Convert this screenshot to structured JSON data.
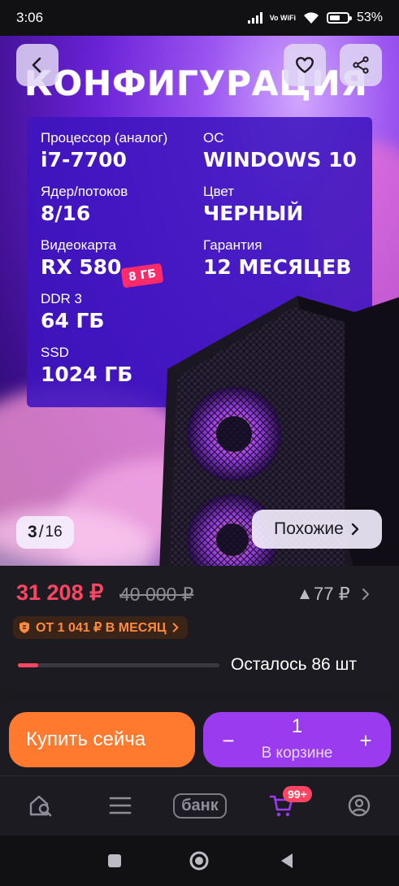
{
  "status_bar": {
    "time": "3:06",
    "network_label": "Vo WiFi",
    "battery": "53%"
  },
  "hero": {
    "title": "КОНФИГУРАЦИЯ",
    "specs": [
      {
        "label": "Процессор (аналог)",
        "value": "i7-7700"
      },
      {
        "label": "ОС",
        "value": "WINDOWS 10"
      },
      {
        "label": "Ядер/потоков",
        "value": "8/16"
      },
      {
        "label": "Цвет",
        "value": "ЧЕРНЫЙ"
      },
      {
        "label": "Видеокарта",
        "value": "RX 580"
      },
      {
        "label": "Гарантия",
        "value": "12 МЕСЯЦЕВ"
      },
      {
        "label": "DDR 3",
        "value": "64 ГБ"
      },
      {
        "label": "SSD",
        "value": "1024 ГБ"
      }
    ],
    "vram_badge": "8 ГБ",
    "gallery": {
      "current": "3",
      "separator": "/",
      "total": "16"
    },
    "similar_label": "Похожие",
    "icons": {
      "back": "chevron-left-icon",
      "favorite": "heart-icon",
      "share": "share-icon"
    }
  },
  "price": {
    "current": "31 208 ₽",
    "old": "40 000 ₽",
    "cashback": "77 ₽",
    "installment": "ОТ 1 041 ₽ В МЕСЯЦ",
    "stock_text": "Осталось 86 шт",
    "stock_level": 0.1
  },
  "actions": {
    "buy_label": "Купить сейча",
    "cart_quantity": "1",
    "cart_label": "В корзине",
    "minus": "−",
    "plus": "+"
  },
  "bottom_nav": {
    "items": [
      "home-search-icon",
      "catalog-menu-icon",
      "bank",
      "cart-icon",
      "profile-icon"
    ],
    "bank_label": "банк",
    "cart_badge": "99+"
  },
  "colors": {
    "accent_red": "#ff4561",
    "buy_orange": "#ff7a2f",
    "cart_purple": "#9a3bef",
    "installment_orange": "#ff8a3d"
  }
}
